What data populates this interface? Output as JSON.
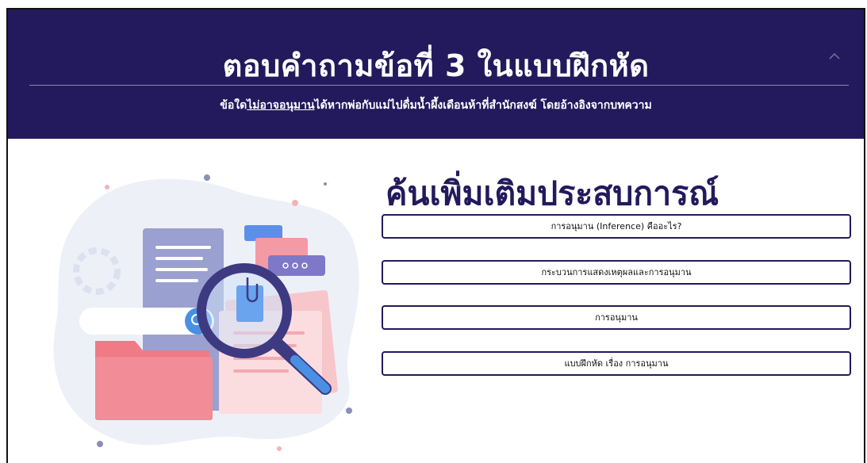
{
  "header": {
    "title": "ตอบคำถามข้อที่ 3 ในแบบฝึกหัด",
    "question_prefix": "ข้อใด",
    "question_emphasis": "ไม่อาจอนุมาน",
    "question_suffix": "ได้หากพ่อกับแม่ไปดื่มน้ำผึ้งเดือนห้าที่สำนักสงฆ์ โดยอ้างอิงจากบทความ",
    "collapse_icon": "chevron-up-icon"
  },
  "main": {
    "title": "ค้นเพิ่มเติมประสบการณ์",
    "links": [
      {
        "label": "การอนุมาน (Inference) คืออะไร?"
      },
      {
        "label": "กระบวนการแสดงเหตุผลและการอนุมาน"
      },
      {
        "label": "การอนุมาน"
      },
      {
        "label": "แบบฝึกหัด เรื่อง การอนุมาน"
      }
    ]
  },
  "colors": {
    "header_bg": "#221a5c",
    "accent_blue": "#4a90e2",
    "accent_pink": "#f07a86"
  }
}
